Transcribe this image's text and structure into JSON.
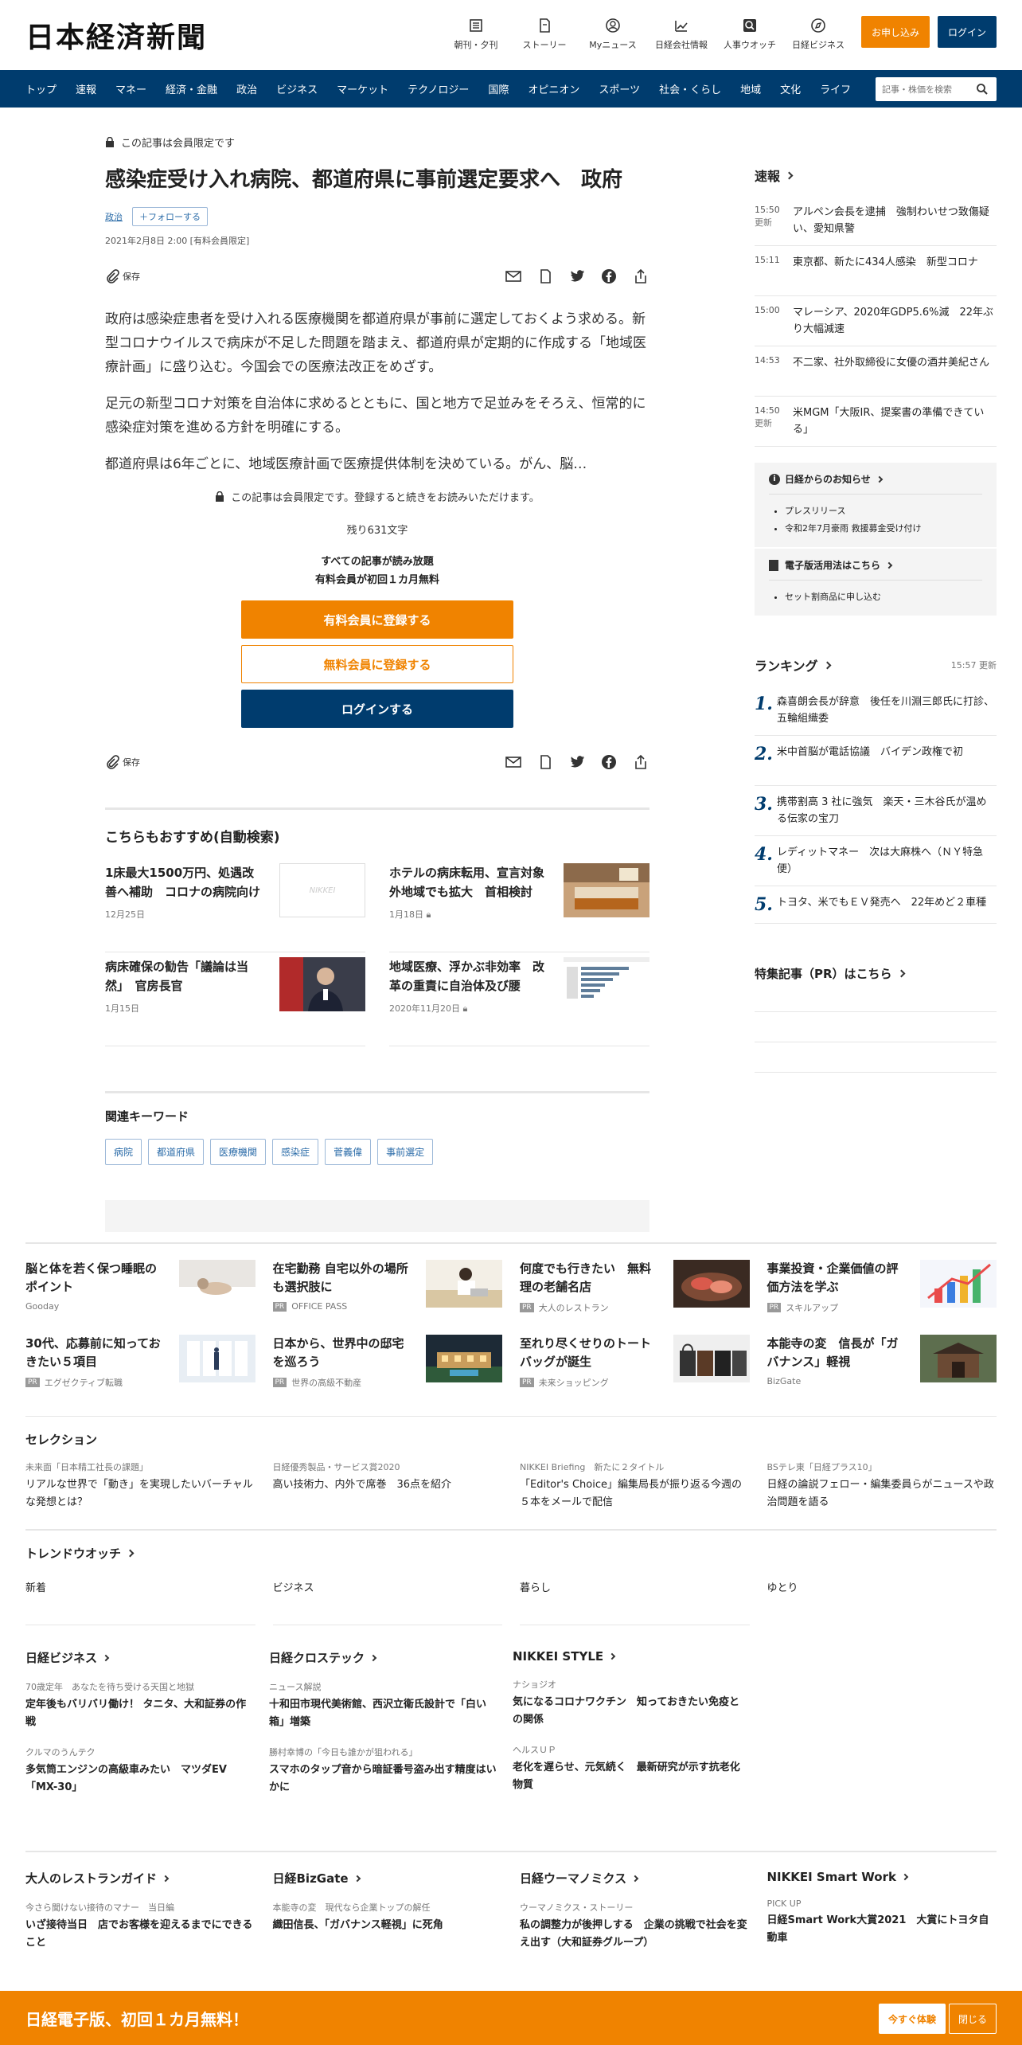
{
  "header": {
    "logo": "日本経済新聞",
    "nav": [
      {
        "label": "朝刊・夕刊",
        "icon": "newspaper-icon"
      },
      {
        "label": "ストーリー",
        "icon": "book-icon"
      },
      {
        "label": "Myニュース",
        "icon": "user-icon"
      },
      {
        "label": "日経会社情報",
        "icon": "chart-icon"
      },
      {
        "label": "人事ウオッチ",
        "icon": "search-person-icon"
      },
      {
        "label": "日経ビジネス",
        "icon": "compass-icon"
      }
    ],
    "apply_label": "お申し込み",
    "login_label": "ログイン"
  },
  "navbar": {
    "items": [
      "トップ",
      "速報",
      "マネー",
      "経済・金融",
      "政治",
      "ビジネス",
      "マーケット",
      "テクノロジー",
      "国際",
      "オピニオン",
      "スポーツ",
      "社会・くらし",
      "地域",
      "文化",
      "ライフ"
    ],
    "search_placeholder": "記事・株価を検索"
  },
  "article": {
    "members_only": "この記事は会員限定です",
    "title": "感染症受け入れ病院、都道府県に事前選定要求へ　政府",
    "category": "政治",
    "follow_label": "フォローする",
    "date": "2021年2月8日 2:00 [有料会員限定]",
    "save_label": "保存",
    "paragraphs": [
      "政府は感染症患者を受け入れる医療機関を都道府県が事前に選定しておくよう求める。新型コロナウイルスで病床が不足した問題を踏まえ、都道府県が定期的に作成する「地域医療計画」に盛り込む。今国会での医療法改正をめざす。",
      "足元の新型コロナ対策を自治体に求めるとともに、国と地方で足並みをそろえ、恒常的に感染症対策を進める方針を明確にする。",
      "都道府県は6年ごとに、地域医療計画で医療提供体制を決めている。がん、脳…"
    ],
    "paywall_msg": "この記事は会員限定です。登録すると続きをお読みいただけます。",
    "remaining": "残り631文字",
    "benefit1": "すべての記事が読み放題",
    "benefit2": "有料会員が初回１カ月無料",
    "btn_paid": "有料会員に登録する",
    "btn_free": "無料会員に登録する",
    "btn_login": "ログインする"
  },
  "recommend": {
    "heading": "こちらもおすすめ(自動検索)",
    "items": [
      {
        "title": "1床最大1500万円、処遇改善へ補助　コロナの病院向け",
        "date": "12月25日",
        "thumb_text": "NIKKEI"
      },
      {
        "title": "ホテルの病床転用、宣言対象外地域でも拡大　首相検討",
        "date": "1月18日"
      },
      {
        "title": "病床確保の勧告「議論は当然」　官房長官",
        "date": "1月15日"
      },
      {
        "title": "地域医療、浮かぶ非効率　改革の重責に自治体及び腰",
        "date": "2020年11月20日"
      }
    ]
  },
  "keywords": {
    "heading": "関連キーワード",
    "items": [
      "病院",
      "都道府県",
      "医療機関",
      "感染症",
      "菅義偉",
      "事前選定"
    ]
  },
  "sidebar": {
    "sokuho_heading": "速報",
    "sokuho": [
      {
        "time": "15:50",
        "updated": "更新",
        "title": "アルペン会長を逮捕　強制わいせつ致傷疑い、愛知県警"
      },
      {
        "time": "15:11",
        "updated": "",
        "title": "東京都、新たに434人感染　新型コロナ"
      },
      {
        "time": "15:00",
        "updated": "",
        "title": "マレーシア、2020年GDP5.6%減　22年ぶり大幅減速"
      },
      {
        "time": "14:53",
        "updated": "",
        "title": "不二家、社外取締役に女優の酒井美紀さん"
      },
      {
        "time": "14:50",
        "updated": "更新",
        "title": "米MGM「大阪IR、提案書の準備できている」"
      }
    ],
    "info_heading": "日経からのお知らせ",
    "info_items": [
      "プレスリリース",
      "令和2年7月豪雨 救援募金受け付け"
    ],
    "digital_heading": "電子版活用法はこちら",
    "digital_items": [
      "セット割商品に申し込む"
    ],
    "ranking_heading": "ランキング",
    "ranking_time": "15:57  更新",
    "ranking": [
      {
        "num": "1.",
        "title": "森喜朗会長が辞意　後任を川淵三郎氏に打診、五輪組織委"
      },
      {
        "num": "2.",
        "title": "米中首脳が電話協議　バイデン政権で初"
      },
      {
        "num": "3.",
        "title": "携帯割高 3 社に強気　楽天・三木谷氏が温める伝家の宝刀"
      },
      {
        "num": "4.",
        "title": "レディットマネー　次は大麻株へ（ＮＹ特急便）"
      },
      {
        "num": "5.",
        "title": "トヨタ、米でもＥＶ発売へ　22年めど２車種"
      }
    ],
    "pr_heading": "特集記事（PR）はこちら"
  },
  "ads": [
    {
      "title": "脳と体を若く保つ睡眠のポイント",
      "source": "Gooday",
      "pr": false
    },
    {
      "title": "在宅勤務 自宅以外の場所も選択肢に",
      "source": "OFFICE PASS",
      "pr": true
    },
    {
      "title": "何度でも行きたい　無料理の老舗名店",
      "source": "大人のレストラン",
      "pr": true
    },
    {
      "title": "事業投資・企業価値の評価方法を学ぶ",
      "source": "スキルアップ",
      "pr": true
    },
    {
      "title": "30代、応募前に知っておきたい５項目",
      "source": "エグゼクティブ転職",
      "pr": true
    },
    {
      "title": "日本から、世界中の邸宅を巡ろう",
      "source": "世界の高級不動産",
      "pr": true
    },
    {
      "title": "至れり尽くせりのトートバッグが誕生",
      "source": "未来ショッピング",
      "pr": true
    },
    {
      "title": "本能寺の変　信長が「ガバナンス」軽視",
      "source": "BizGate",
      "pr": false
    }
  ],
  "pr_label": "PR",
  "selection": {
    "heading": "セレクション",
    "items": [
      {
        "kicker": "未来面「日本精工社長の課題」",
        "title": "リアルな世界で「動き」を実現したいバーチャルな発想とは？"
      },
      {
        "kicker": "日経優秀製品・サービス賞2020",
        "title": "高い技術力、内外で席巻　36点を紹介"
      },
      {
        "kicker": "NIKKEI Briefing　新たに２タイトル",
        "title": "「Editor's Choice」編集局長が振り返る今週の５本をメールで配信"
      },
      {
        "kicker": "BSテレ東「日経プラス10」",
        "title": "日経の論説フェロー・編集委員らがニュースや政治問題を語る"
      }
    ]
  },
  "trend": {
    "heading": "トレンドウオッチ",
    "cols": [
      "新着",
      "ビジネス",
      "暮らし",
      "ゆとり"
    ]
  },
  "media": [
    {
      "heading": "日経ビジネス",
      "items": [
        {
          "kicker": "70歳定年　あなたを待ち受ける天国と地獄",
          "title": "定年後もバリバリ働け！ タニタ、大和証券の作戦"
        },
        {
          "kicker": "クルマのうんテク",
          "title": "多気筒エンジンの高級車みたい　マツダEV「MX-30」"
        }
      ]
    },
    {
      "heading": "日経クロステック",
      "items": [
        {
          "kicker": "ニュース解説",
          "title": "十和田市現代美術館、西沢立衛氏設計で「白い箱」増築"
        },
        {
          "kicker": "勝村幸博の「今日も誰かが狙われる」",
          "title": "スマホのタップ音から暗証番号盗み出す精度はいかに"
        }
      ]
    },
    {
      "heading": "NIKKEI STYLE",
      "items": [
        {
          "kicker": "ナショジオ",
          "title": "気になるコロナワクチン　知っておきたい免疫との関係"
        },
        {
          "kicker": "ヘルスＵＰ",
          "title": "老化を遅らせ、元気続く　最新研究が示す抗老化物質"
        }
      ]
    }
  ],
  "bottom": [
    {
      "heading": "大人のレストランガイド",
      "kicker": "今さら聞けない接待のマナー　当日編",
      "title": "いざ接待当日　店でお客様を迎えるまでにできること"
    },
    {
      "heading": "日経BizGate",
      "kicker": "本能寺の変　現代なら企業トップの解任",
      "title": "織田信長、「ガバナンス軽視」に死角"
    },
    {
      "heading": "日経ウーマノミクス",
      "kicker": "ウーマノミクス・ストーリー",
      "title": "私の調整力が後押しする　企業の挑戦で社会を変え出す（大和証券グループ）"
    },
    {
      "heading": "NIKKEI Smart Work",
      "kicker": "PICK UP",
      "title": "日経Smart Work大賞2021　大賞にトヨタ自動車"
    }
  ],
  "banner": {
    "text": "日経電子版、初回１カ月無料！",
    "btn_trial": "今すぐ体験",
    "btn_close": "閉じる"
  },
  "colors": {
    "navy": "#003c6e",
    "orange": "#f08300",
    "link": "#2a6ba8"
  }
}
